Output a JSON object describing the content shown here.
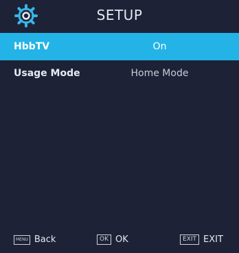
{
  "header": {
    "title": "SETUP",
    "icon": "gear-icon"
  },
  "menu": {
    "items": [
      {
        "label": "HbbTV",
        "value": "On",
        "selected": true
      },
      {
        "label": "Usage Mode",
        "value": "Home Mode",
        "selected": false
      }
    ]
  },
  "footer": {
    "menu_key": "MENU",
    "menu_label": "Back",
    "ok_key": "OK",
    "ok_label": "OK",
    "exit_key": "EXIT",
    "exit_label": "EXIT"
  },
  "colors": {
    "background": "#1e2236",
    "highlight": "#23b3e6",
    "icon": "#35b7ea"
  }
}
